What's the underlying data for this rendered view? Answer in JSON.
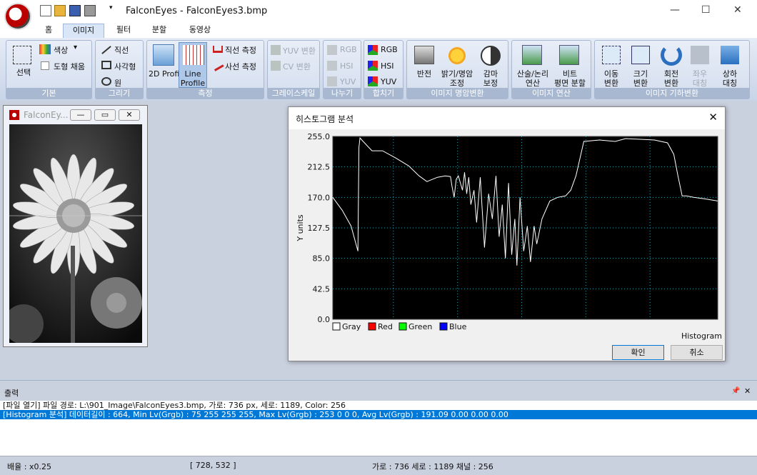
{
  "window": {
    "app_name": "FalconEyes",
    "title": "FalconEyes - FalconEyes3.bmp",
    "minimize": "—",
    "maximize": "☐",
    "close": "✕"
  },
  "quick_access": {
    "customize": "▾"
  },
  "tabs": [
    {
      "label": "홈"
    },
    {
      "label": "이미지",
      "active": true
    },
    {
      "label": "필터"
    },
    {
      "label": "분할"
    },
    {
      "label": "동영상"
    }
  ],
  "ribbon": {
    "basic": {
      "label": "기본",
      "select": "선택",
      "color": "색상",
      "color_dropdown": "▾",
      "fill_shape": "도형 채움"
    },
    "draw": {
      "label": "그리기",
      "line": "직선",
      "rect": "사각형",
      "circle": "원"
    },
    "measure": {
      "label": "측정",
      "profile2d": "2D Profile",
      "line_profile": "Line Profile",
      "line_measure": "직선 측정",
      "oblique_measure": "사선 측정"
    },
    "grayscale": {
      "label": "그레이스케일",
      "yuv_convert": "YUV 변환",
      "cv_convert": "CV 변환"
    },
    "split": {
      "label": "나누기",
      "rgb": "RGB",
      "hsi": "HSI",
      "yuv": "YUV"
    },
    "merge": {
      "label": "합치기",
      "rgb": "RGB",
      "hsi": "HSI",
      "yuv": "YUV"
    },
    "tone": {
      "label": "이미지 명암변환",
      "invert": "반전",
      "brightness": "밝기/명암",
      "brightness2": "조정",
      "gamma": "감마",
      "gamma2": "보정"
    },
    "arith": {
      "label": "이미지 연산",
      "arith": "산술/논리",
      "arith2": "연산",
      "bitplane": "비트",
      "bitplane2": "평면 분할"
    },
    "geom": {
      "label": "이미지 기하변환",
      "move": "이동",
      "move2": "변환",
      "resize": "크기",
      "resize2": "변환",
      "rotate": "회전",
      "rotate2": "변환",
      "mirror": "좌우",
      "mirror2": "대칭",
      "flip": "상하",
      "flip2": "대칭"
    }
  },
  "child_window": {
    "title": "FalconEy...",
    "min": "—",
    "restore": "▭",
    "close": "✕"
  },
  "dialog": {
    "title": "히스토그램 분석",
    "close": "✕",
    "ok": "확인",
    "cancel": "취소"
  },
  "chart_data": {
    "type": "line",
    "ylabel": "Y units",
    "xlabel": "Histogram",
    "ylim": [
      0,
      255
    ],
    "y_ticks": [
      "255.0",
      "212.5",
      "170.0",
      "127.5",
      "85.0",
      "42.5",
      "0.0"
    ],
    "x_range": [
      0,
      736
    ],
    "grid": true,
    "legend": [
      {
        "name": "Gray",
        "color": "#ffffff"
      },
      {
        "name": "Red",
        "color": "#ff0000"
      },
      {
        "name": "Green",
        "color": "#00ff00"
      },
      {
        "name": "Blue",
        "color": "#0000ff"
      }
    ],
    "series": [
      {
        "name": "Gray",
        "x": [
          0,
          18,
          35,
          48,
          50,
          52,
          58,
          75,
          95,
          120,
          145,
          165,
          180,
          200,
          215,
          225,
          228,
          232,
          236,
          240,
          248,
          252,
          256,
          260,
          264,
          270,
          275,
          282,
          290,
          298,
          305,
          312,
          318,
          324,
          330,
          336,
          342,
          348,
          352,
          358,
          365,
          372,
          378,
          385,
          390,
          400,
          415,
          430,
          445,
          455,
          465,
          480,
          510,
          540,
          560,
          615,
          640,
          652,
          660,
          668,
          676,
          690,
          710,
          736
        ],
        "values": [
          170,
          152,
          130,
          95,
          240,
          253,
          248,
          235,
          235,
          225,
          214,
          200,
          192,
          198,
          200,
          199,
          185,
          170,
          195,
          200,
          180,
          205,
          175,
          198,
          160,
          180,
          135,
          198,
          100,
          175,
          140,
          200,
          115,
          160,
          85,
          190,
          90,
          140,
          75,
          170,
          95,
          130,
          80,
          130,
          105,
          140,
          165,
          170,
          172,
          180,
          200,
          248,
          250,
          248,
          252,
          250,
          246,
          230,
          200,
          172,
          172,
          170,
          168,
          165
        ]
      }
    ]
  },
  "output": {
    "title": "출력",
    "pin": "📌",
    "close": "✕",
    "lines": [
      "[파일 열기] 파일 경로: L:\\901_Image\\FalconEyes3.bmp, 가로: 736 px, 세로: 1189, Color: 256",
      "[Histogram 분석] 데이터길이 : 664, Min Lv(Grgb) : 75 255 255 255, Max Lv(Grgb) : 253 0 0 0, Avg Lv(Grgb) : 191.09 0.00 0.00 0.00"
    ]
  },
  "status": {
    "zoom": "배율 : x0.25",
    "coords": "[ 728, 532 ]",
    "dims": "가로 : 736  세로 : 1189  채널 : 256"
  }
}
